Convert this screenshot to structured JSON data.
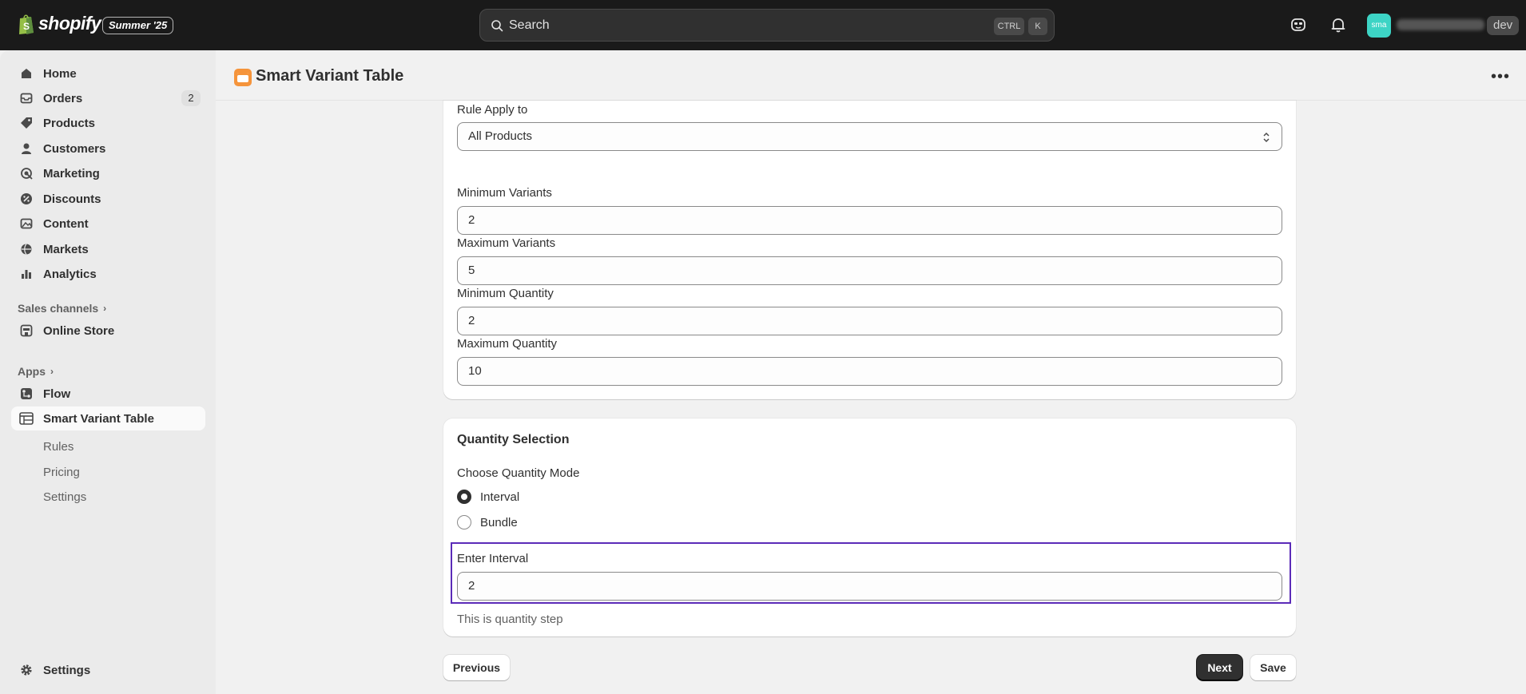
{
  "topbar": {
    "brand": "shopify",
    "edition_badge": "Summer '25",
    "search": {
      "label": "Search",
      "shortcut_ctrl": "CTRL",
      "shortcut_key": "K"
    },
    "avatar_initials": "sma",
    "store_tag": "dev"
  },
  "sidebar": {
    "items": [
      {
        "label": "Home",
        "icon": "home-icon"
      },
      {
        "label": "Orders",
        "icon": "orders-icon",
        "count": "2"
      },
      {
        "label": "Products",
        "icon": "tag-icon"
      },
      {
        "label": "Customers",
        "icon": "person-icon"
      },
      {
        "label": "Marketing",
        "icon": "target-icon"
      },
      {
        "label": "Discounts",
        "icon": "discount-icon"
      },
      {
        "label": "Content",
        "icon": "image-icon"
      },
      {
        "label": "Markets",
        "icon": "globe-icon"
      },
      {
        "label": "Analytics",
        "icon": "chart-icon"
      }
    ],
    "sales_channels_label": "Sales channels",
    "online_store": "Online Store",
    "apps_label": "Apps",
    "flow": "Flow",
    "app_active": "Smart Variant Table",
    "app_subitems": [
      "Rules",
      "Pricing",
      "Settings"
    ],
    "settings": "Settings"
  },
  "page": {
    "title": "Smart Variant Table"
  },
  "rule_card": {
    "apply_label": "Rule Apply to",
    "apply_value": "All Products",
    "min_variants_label": "Minimum Variants",
    "min_variants_value": "2",
    "max_variants_label": "Maximum Variants",
    "max_variants_value": "5",
    "min_qty_label": "Minimum Quantity",
    "min_qty_value": "2",
    "max_qty_label": "Maximum Quantity",
    "max_qty_value": "10"
  },
  "quantity_card": {
    "title": "Quantity Selection",
    "mode_label": "Choose Quantity Mode",
    "option_interval": "Interval",
    "option_bundle": "Bundle",
    "interval_label": "Enter Interval",
    "interval_value": "2",
    "help": "This is quantity step"
  },
  "footer": {
    "previous": "Previous",
    "next": "Next",
    "save": "Save"
  }
}
